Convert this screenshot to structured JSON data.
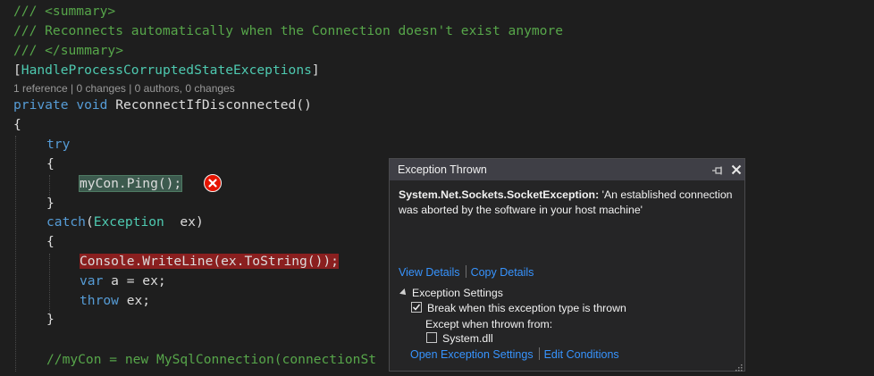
{
  "code": {
    "summary_open": "/// <summary>",
    "summary_text": "/// Reconnects automatically when the Connection doesn't exist anymore",
    "summary_close": "/// </summary>",
    "attr_open": "[",
    "attr_name": "HandleProcessCorruptedStateExceptions",
    "attr_close": "]",
    "codelens": "1 reference | 0 changes | 0 authors, 0 changes",
    "kw_private": "private",
    "kw_void": "void",
    "method_sig": "ReconnectIfDisconnected()",
    "brace_open": "{",
    "brace_close": "}",
    "kw_try": "try",
    "ping_stmt": "myCon.Ping();",
    "kw_catch": "catch",
    "catch_paren_open": "(",
    "catch_type": "Exception",
    "catch_var": "  ex)",
    "writeline_stmt": "Console.WriteLine(ex.ToString());",
    "kw_var": "var",
    "var_rest": " a = ex;",
    "kw_throw": "throw",
    "throw_rest": " ex;",
    "last_comment": "//myCon = new MySqlConnection(connectionSt"
  },
  "exception_popup": {
    "title": "Exception Thrown",
    "exception_type": "System.Net.Sockets.SocketException:",
    "exception_message": "'An established connection was aborted by the software in your host machine'",
    "view_details": "View Details",
    "copy_details": "Copy Details",
    "settings_header": "Exception Settings",
    "break_when_thrown": "Break when this exception type is thrown",
    "break_when_thrown_checked": true,
    "except_when_from": "Except when thrown from:",
    "system_dll": "System.dll",
    "system_dll_checked": false,
    "open_settings": "Open Exception Settings",
    "edit_conditions": "Edit Conditions"
  },
  "icons": {
    "error": "error-circle-icon",
    "pin": "pin-icon",
    "close": "close-icon",
    "resize": "resize-grip-icon"
  },
  "colors": {
    "background": "#1e1e1e",
    "comment": "#57a64a",
    "keyword": "#569cd6",
    "type": "#4ec9b0",
    "link": "#3794ff",
    "error": "#e51400"
  }
}
